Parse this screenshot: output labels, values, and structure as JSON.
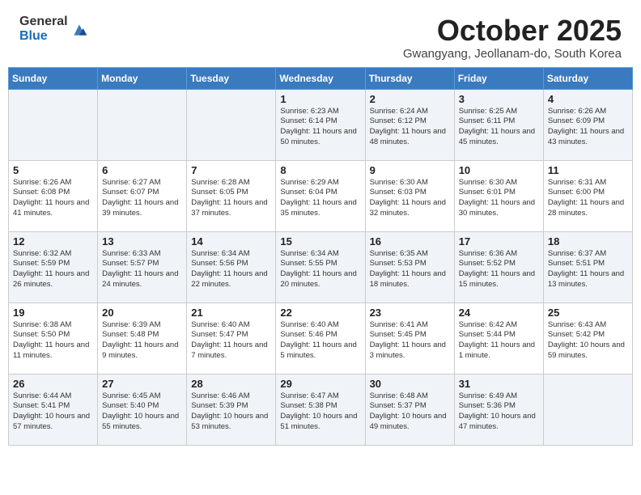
{
  "header": {
    "logo_general": "General",
    "logo_blue": "Blue",
    "month_title": "October 2025",
    "location": "Gwangyang, Jeollanam-do, South Korea"
  },
  "days_of_week": [
    "Sunday",
    "Monday",
    "Tuesday",
    "Wednesday",
    "Thursday",
    "Friday",
    "Saturday"
  ],
  "weeks": [
    [
      {
        "day": "",
        "info": ""
      },
      {
        "day": "",
        "info": ""
      },
      {
        "day": "",
        "info": ""
      },
      {
        "day": "1",
        "info": "Sunrise: 6:23 AM\nSunset: 6:14 PM\nDaylight: 11 hours\nand 50 minutes."
      },
      {
        "day": "2",
        "info": "Sunrise: 6:24 AM\nSunset: 6:12 PM\nDaylight: 11 hours\nand 48 minutes."
      },
      {
        "day": "3",
        "info": "Sunrise: 6:25 AM\nSunset: 6:11 PM\nDaylight: 11 hours\nand 45 minutes."
      },
      {
        "day": "4",
        "info": "Sunrise: 6:26 AM\nSunset: 6:09 PM\nDaylight: 11 hours\nand 43 minutes."
      }
    ],
    [
      {
        "day": "5",
        "info": "Sunrise: 6:26 AM\nSunset: 6:08 PM\nDaylight: 11 hours\nand 41 minutes."
      },
      {
        "day": "6",
        "info": "Sunrise: 6:27 AM\nSunset: 6:07 PM\nDaylight: 11 hours\nand 39 minutes."
      },
      {
        "day": "7",
        "info": "Sunrise: 6:28 AM\nSunset: 6:05 PM\nDaylight: 11 hours\nand 37 minutes."
      },
      {
        "day": "8",
        "info": "Sunrise: 6:29 AM\nSunset: 6:04 PM\nDaylight: 11 hours\nand 35 minutes."
      },
      {
        "day": "9",
        "info": "Sunrise: 6:30 AM\nSunset: 6:03 PM\nDaylight: 11 hours\nand 32 minutes."
      },
      {
        "day": "10",
        "info": "Sunrise: 6:30 AM\nSunset: 6:01 PM\nDaylight: 11 hours\nand 30 minutes."
      },
      {
        "day": "11",
        "info": "Sunrise: 6:31 AM\nSunset: 6:00 PM\nDaylight: 11 hours\nand 28 minutes."
      }
    ],
    [
      {
        "day": "12",
        "info": "Sunrise: 6:32 AM\nSunset: 5:59 PM\nDaylight: 11 hours\nand 26 minutes."
      },
      {
        "day": "13",
        "info": "Sunrise: 6:33 AM\nSunset: 5:57 PM\nDaylight: 11 hours\nand 24 minutes."
      },
      {
        "day": "14",
        "info": "Sunrise: 6:34 AM\nSunset: 5:56 PM\nDaylight: 11 hours\nand 22 minutes."
      },
      {
        "day": "15",
        "info": "Sunrise: 6:34 AM\nSunset: 5:55 PM\nDaylight: 11 hours\nand 20 minutes."
      },
      {
        "day": "16",
        "info": "Sunrise: 6:35 AM\nSunset: 5:53 PM\nDaylight: 11 hours\nand 18 minutes."
      },
      {
        "day": "17",
        "info": "Sunrise: 6:36 AM\nSunset: 5:52 PM\nDaylight: 11 hours\nand 15 minutes."
      },
      {
        "day": "18",
        "info": "Sunrise: 6:37 AM\nSunset: 5:51 PM\nDaylight: 11 hours\nand 13 minutes."
      }
    ],
    [
      {
        "day": "19",
        "info": "Sunrise: 6:38 AM\nSunset: 5:50 PM\nDaylight: 11 hours\nand 11 minutes."
      },
      {
        "day": "20",
        "info": "Sunrise: 6:39 AM\nSunset: 5:48 PM\nDaylight: 11 hours\nand 9 minutes."
      },
      {
        "day": "21",
        "info": "Sunrise: 6:40 AM\nSunset: 5:47 PM\nDaylight: 11 hours\nand 7 minutes."
      },
      {
        "day": "22",
        "info": "Sunrise: 6:40 AM\nSunset: 5:46 PM\nDaylight: 11 hours\nand 5 minutes."
      },
      {
        "day": "23",
        "info": "Sunrise: 6:41 AM\nSunset: 5:45 PM\nDaylight: 11 hours\nand 3 minutes."
      },
      {
        "day": "24",
        "info": "Sunrise: 6:42 AM\nSunset: 5:44 PM\nDaylight: 11 hours\nand 1 minute."
      },
      {
        "day": "25",
        "info": "Sunrise: 6:43 AM\nSunset: 5:42 PM\nDaylight: 10 hours\nand 59 minutes."
      }
    ],
    [
      {
        "day": "26",
        "info": "Sunrise: 6:44 AM\nSunset: 5:41 PM\nDaylight: 10 hours\nand 57 minutes."
      },
      {
        "day": "27",
        "info": "Sunrise: 6:45 AM\nSunset: 5:40 PM\nDaylight: 10 hours\nand 55 minutes."
      },
      {
        "day": "28",
        "info": "Sunrise: 6:46 AM\nSunset: 5:39 PM\nDaylight: 10 hours\nand 53 minutes."
      },
      {
        "day": "29",
        "info": "Sunrise: 6:47 AM\nSunset: 5:38 PM\nDaylight: 10 hours\nand 51 minutes."
      },
      {
        "day": "30",
        "info": "Sunrise: 6:48 AM\nSunset: 5:37 PM\nDaylight: 10 hours\nand 49 minutes."
      },
      {
        "day": "31",
        "info": "Sunrise: 6:49 AM\nSunset: 5:36 PM\nDaylight: 10 hours\nand 47 minutes."
      },
      {
        "day": "",
        "info": ""
      }
    ]
  ]
}
